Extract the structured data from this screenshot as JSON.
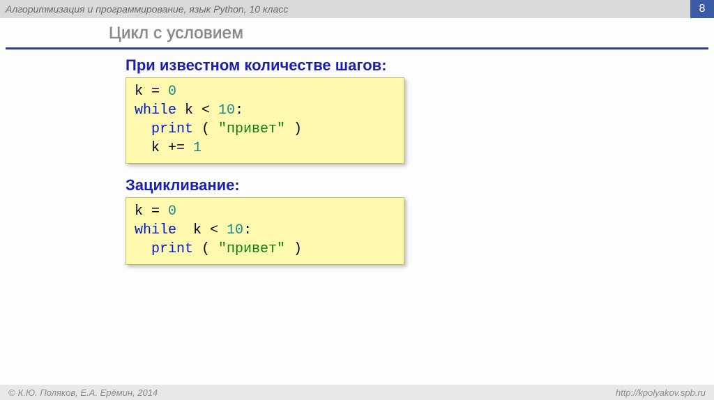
{
  "header": {
    "title": "Алгоритмизация и программирование, язык Python, 10 класс",
    "slide_number": "8"
  },
  "slide_title": "Цикл с условием",
  "section1": {
    "title": "При известном количестве шагов:",
    "code": {
      "l1_a": "k",
      "l1_b": " = ",
      "l1_c": "0",
      "l2_a": "while",
      "l2_b": " k",
      "l2_c": " < ",
      "l2_d": "10",
      "l2_e": ":",
      "l3_a": "  print",
      "l3_b": " ( ",
      "l3_c": "\"привет\"",
      "l3_d": " )",
      "l4_a": "  k ",
      "l4_b": "+= ",
      "l4_c": "1"
    }
  },
  "section2": {
    "title": "Зацикливание:",
    "code": {
      "l1_a": "k",
      "l1_b": " = ",
      "l1_c": "0",
      "l2_a": "while",
      "l2_b": "  k",
      "l2_c": " < ",
      "l2_d": "10",
      "l2_e": ":",
      "l3_a": "  print",
      "l3_b": " ( ",
      "l3_c": "\"привет\"",
      "l3_d": " )"
    }
  },
  "footer": {
    "copyright": "К.Ю. Поляков, Е.А. Ерёмин, 2014",
    "url": "http://kpolyakov.spb.ru"
  }
}
